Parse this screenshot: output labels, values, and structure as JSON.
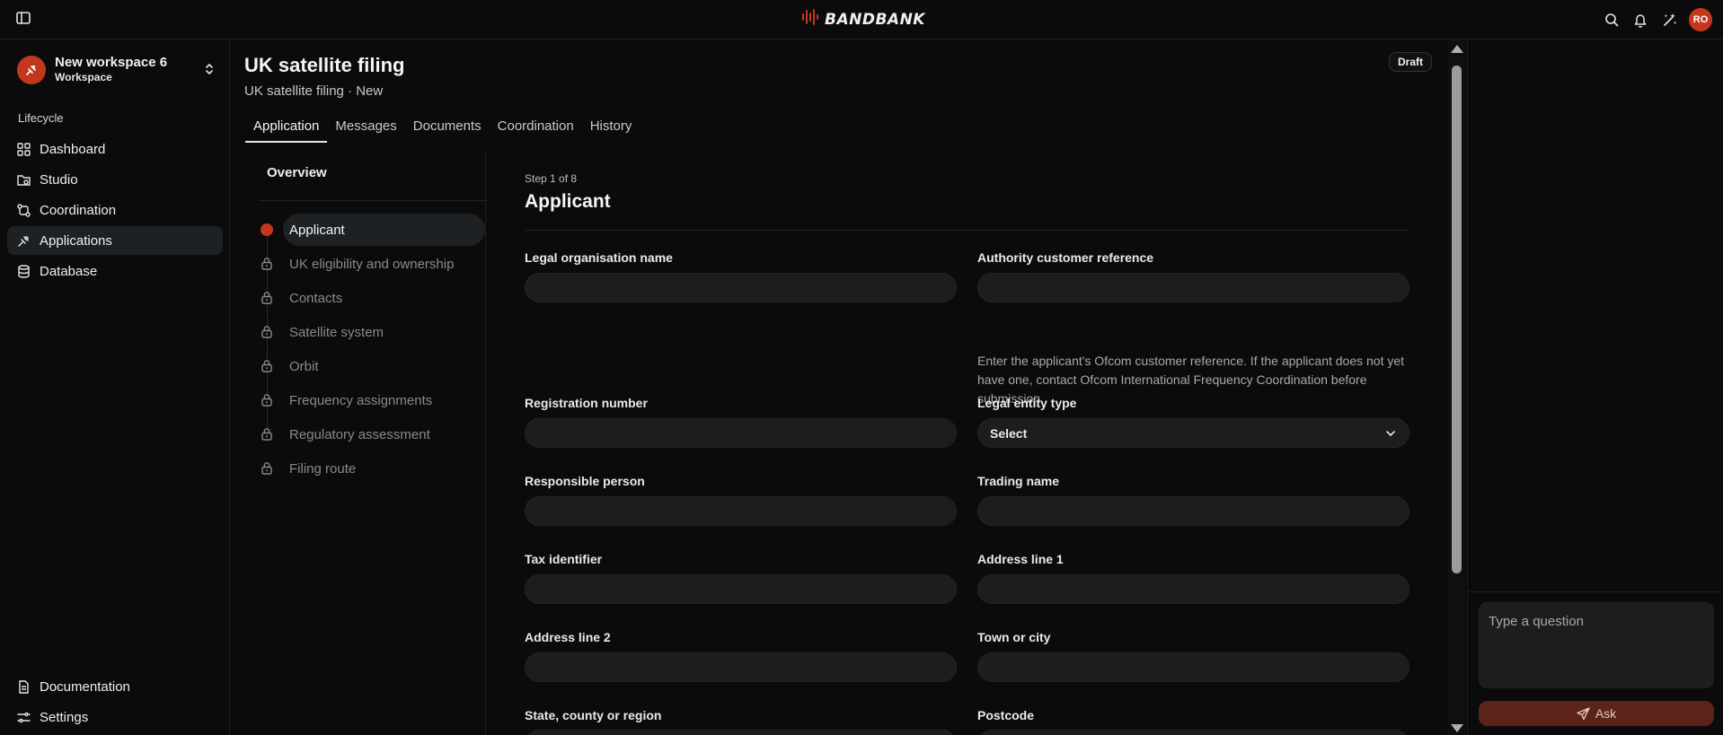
{
  "brand": {
    "name": "BANDBANK"
  },
  "user": {
    "initials": "RO"
  },
  "workspace": {
    "name": "New workspace 6",
    "type": "Workspace"
  },
  "sidebar": {
    "section_label": "Lifecycle",
    "items": [
      {
        "label": "Dashboard",
        "icon": "dashboard-icon"
      },
      {
        "label": "Studio",
        "icon": "studio-icon"
      },
      {
        "label": "Coordination",
        "icon": "coordination-icon"
      },
      {
        "label": "Applications",
        "icon": "applications-icon",
        "active": true
      },
      {
        "label": "Database",
        "icon": "database-icon"
      }
    ],
    "bottom": [
      {
        "label": "Documentation",
        "icon": "document-icon"
      },
      {
        "label": "Settings",
        "icon": "settings-icon"
      }
    ]
  },
  "page": {
    "title": "UK satellite filing",
    "subtitle": "UK satellite filing · New",
    "status": "Draft"
  },
  "tabs": [
    {
      "label": "Application",
      "active": true
    },
    {
      "label": "Messages"
    },
    {
      "label": "Documents"
    },
    {
      "label": "Coordination"
    },
    {
      "label": "History"
    }
  ],
  "steps": {
    "overview_label": "Overview",
    "items": [
      {
        "label": "Applicant",
        "state": "current"
      },
      {
        "label": "UK eligibility and ownership",
        "state": "locked"
      },
      {
        "label": "Contacts",
        "state": "locked"
      },
      {
        "label": "Satellite system",
        "state": "locked"
      },
      {
        "label": "Orbit",
        "state": "locked"
      },
      {
        "label": "Frequency assignments",
        "state": "locked"
      },
      {
        "label": "Regulatory assessment",
        "state": "locked"
      },
      {
        "label": "Filing route",
        "state": "locked"
      }
    ]
  },
  "form": {
    "step_counter": "Step 1 of 8",
    "title": "Applicant",
    "fields": {
      "legal_org_name": {
        "label": "Legal organisation name",
        "value": ""
      },
      "authority_ref": {
        "label": "Authority customer reference",
        "value": "",
        "help": "Enter the applicant's Ofcom customer reference. If the applicant does not yet have one, contact Ofcom International Frequency Coordination before submission."
      },
      "registration_number": {
        "label": "Registration number",
        "value": ""
      },
      "legal_entity_type": {
        "label": "Legal entity type",
        "selected": "Select"
      },
      "responsible_person": {
        "label": "Responsible person",
        "value": ""
      },
      "trading_name": {
        "label": "Trading name",
        "value": ""
      },
      "tax_identifier": {
        "label": "Tax identifier",
        "value": ""
      },
      "address_line_1": {
        "label": "Address line 1",
        "value": ""
      },
      "address_line_2": {
        "label": "Address line 2",
        "value": ""
      },
      "town_or_city": {
        "label": "Town or city",
        "value": ""
      },
      "state_region": {
        "label": "State, county or region",
        "value": ""
      },
      "postcode": {
        "label": "Postcode",
        "value": ""
      }
    }
  },
  "assistant": {
    "placeholder": "Type a question",
    "ask_label": "Ask"
  },
  "colors": {
    "accent": "#c4371f",
    "background": "#0b0b0b",
    "input": "#1c1d1f",
    "active_nav": "#1e2124"
  }
}
